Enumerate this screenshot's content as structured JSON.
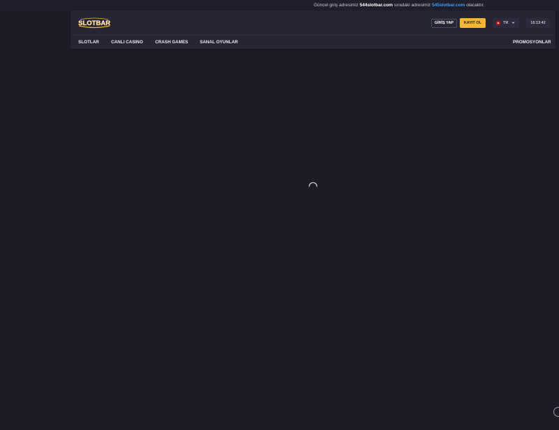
{
  "announcement": {
    "prefix": "Güncel giriş adresimiz",
    "current_domain": "544slotbar.com",
    "middle": "sıradaki adresimiz",
    "next_domain": "545slotbar.com",
    "suffix": "olacaktır."
  },
  "header": {
    "logo_text": "SLOTBAR",
    "login_label": "GİRİŞ YAP",
    "register_label": "KAYIT OL",
    "language_code": "TR",
    "clock": "16:13:42"
  },
  "nav": {
    "items": [
      {
        "label": "SLOTLAR"
      },
      {
        "label": "CANLI CASINO"
      },
      {
        "label": "CRASH GAMES"
      },
      {
        "label": "SANAL OYUNLAR"
      }
    ],
    "promotions_label": "PROMOSYONLAR"
  },
  "colors": {
    "background": "#1c1c27",
    "header": "#252534",
    "accent": "#f5b731",
    "link": "#3d9dff"
  }
}
